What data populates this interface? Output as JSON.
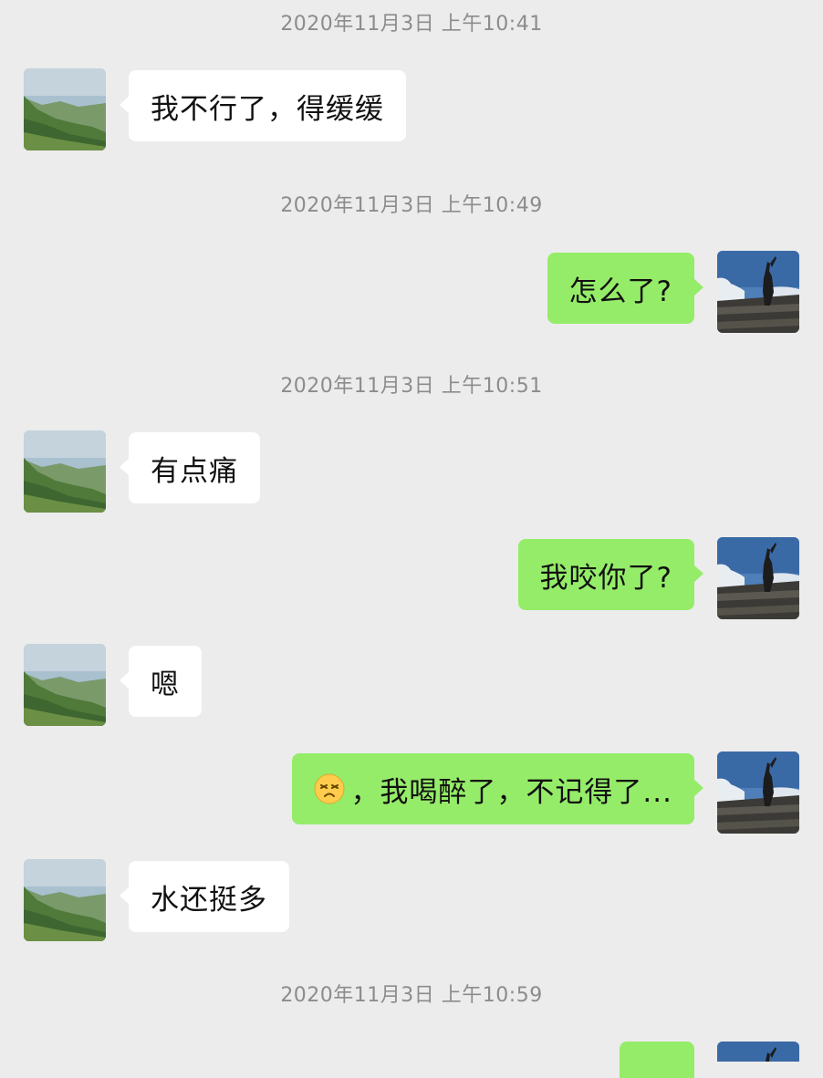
{
  "colors": {
    "background": "#ececec",
    "incoming_bubble": "#ffffff",
    "outgoing_bubble": "#95ec69",
    "timestamp_text": "#8c8c8c"
  },
  "timestamps": [
    "2020年11月3日 上午10:41",
    "2020年11月3日 上午10:49",
    "2020年11月3日 上午10:51",
    "2020年11月3日 上午10:59"
  ],
  "messages": [
    {
      "side": "incoming",
      "text": "我不行了，得缓缓"
    },
    {
      "side": "outgoing",
      "text": "怎么了?"
    },
    {
      "side": "incoming",
      "text": "有点痛"
    },
    {
      "side": "outgoing",
      "text": "我咬你了?"
    },
    {
      "side": "incoming",
      "text": "嗯"
    },
    {
      "side": "outgoing",
      "emoji": "dizzy-face-emoji",
      "text": "，我喝醉了，不记得了..."
    },
    {
      "side": "incoming",
      "text": "水还挺多"
    },
    {
      "side": "outgoing",
      "text": ""
    }
  ],
  "avatars": {
    "contact": "mountain-landscape-avatar",
    "self": "silhouette-sky-avatar"
  }
}
